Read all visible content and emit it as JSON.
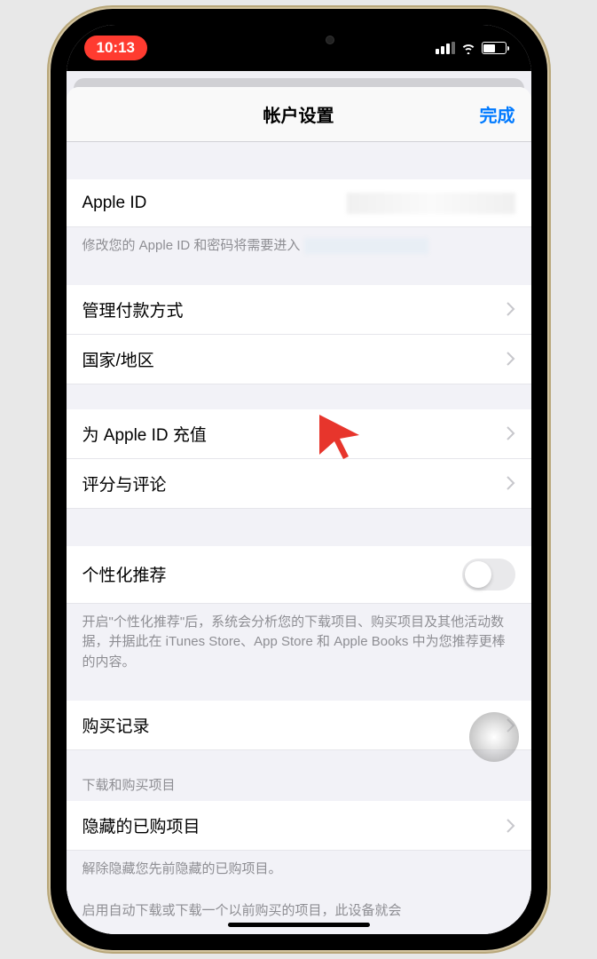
{
  "status": {
    "time": "10:13"
  },
  "nav": {
    "title": "帐户设置",
    "done": "完成"
  },
  "rows": {
    "apple_id": "Apple ID",
    "apple_id_footer": "修改您的 Apple ID 和密码将需要进入",
    "payment": "管理付款方式",
    "country": "国家/地区",
    "add_funds": "为 Apple ID 充值",
    "ratings": "评分与评论",
    "personalized": "个性化推荐",
    "personalized_footer": "开启\"个性化推荐\"后，系统会分析您的下载项目、购买项目及其他活动数据，并据此在 iTunes Store、App Store 和 Apple Books 中为您推荐更棒的内容。",
    "purchase_history": "购买记录",
    "downloads_header": "下载和购买项目",
    "hidden_purchases": "隐藏的已购项目",
    "hidden_footer": "解除隐藏您先前隐藏的已购项目。",
    "auto_download_footer": "启用自动下载或下载一个以前购买的项目，此设备就会"
  }
}
